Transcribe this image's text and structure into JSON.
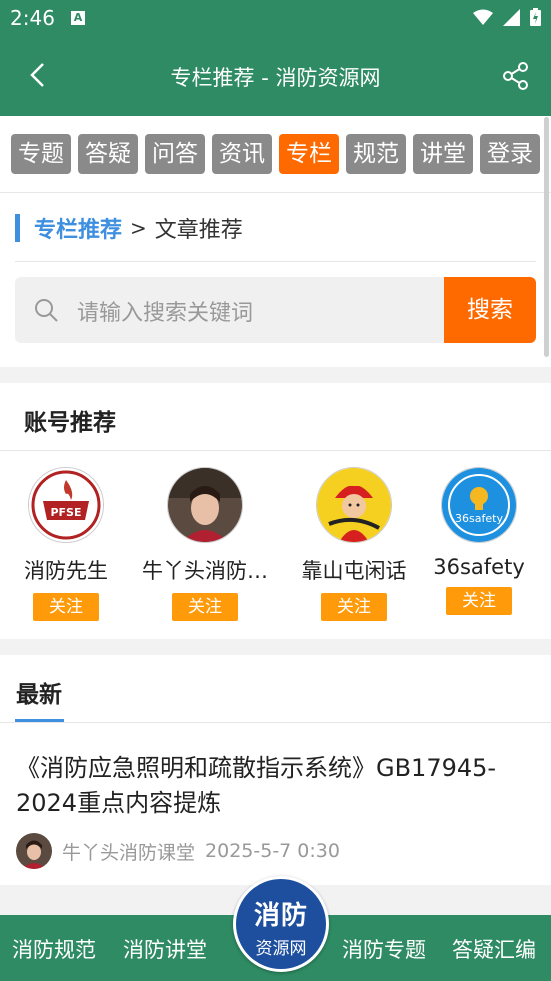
{
  "status_bar": {
    "time": "2:46",
    "notif_icon_letter": "A"
  },
  "app_bar": {
    "title": "专栏推荐 - 消防资源网"
  },
  "tabs": [
    {
      "label": "专题",
      "active": false
    },
    {
      "label": "答疑",
      "active": false
    },
    {
      "label": "问答",
      "active": false
    },
    {
      "label": "资讯",
      "active": false
    },
    {
      "label": "专栏",
      "active": true
    },
    {
      "label": "规范",
      "active": false
    },
    {
      "label": "讲堂",
      "active": false
    },
    {
      "label": "登录",
      "active": false
    }
  ],
  "breadcrumb": {
    "main": "专栏推荐",
    "separator": ">",
    "sub": "文章推荐"
  },
  "search": {
    "placeholder": "请输入搜索关键词",
    "button": "搜索"
  },
  "accounts": {
    "heading": "账号推荐",
    "follow_label": "关注",
    "items": [
      {
        "name": "消防先生",
        "avatar": "pfse-logo"
      },
      {
        "name": "牛丫头消防…",
        "avatar": "person-photo"
      },
      {
        "name": "靠山屯闲话",
        "avatar": "firefighter-cartoon"
      },
      {
        "name": "36safety",
        "avatar": "36safety-logo"
      }
    ]
  },
  "latest": {
    "heading": "最新",
    "article": {
      "title": "《消防应急照明和疏散指示系统》GB17945-2024重点内容提炼",
      "author": "牛丫头消防课堂",
      "date": "2025-5-7 0:30"
    }
  },
  "bottom_nav": {
    "items": [
      "消防规范",
      "消防讲堂",
      "消防专题",
      "答疑汇编"
    ],
    "logo_line1": "消防",
    "logo_line2": "资源网"
  },
  "colors": {
    "primary": "#2e8b63",
    "accent": "#ff6a00",
    "follow": "#ff9a0a",
    "link": "#3e8fe0"
  }
}
